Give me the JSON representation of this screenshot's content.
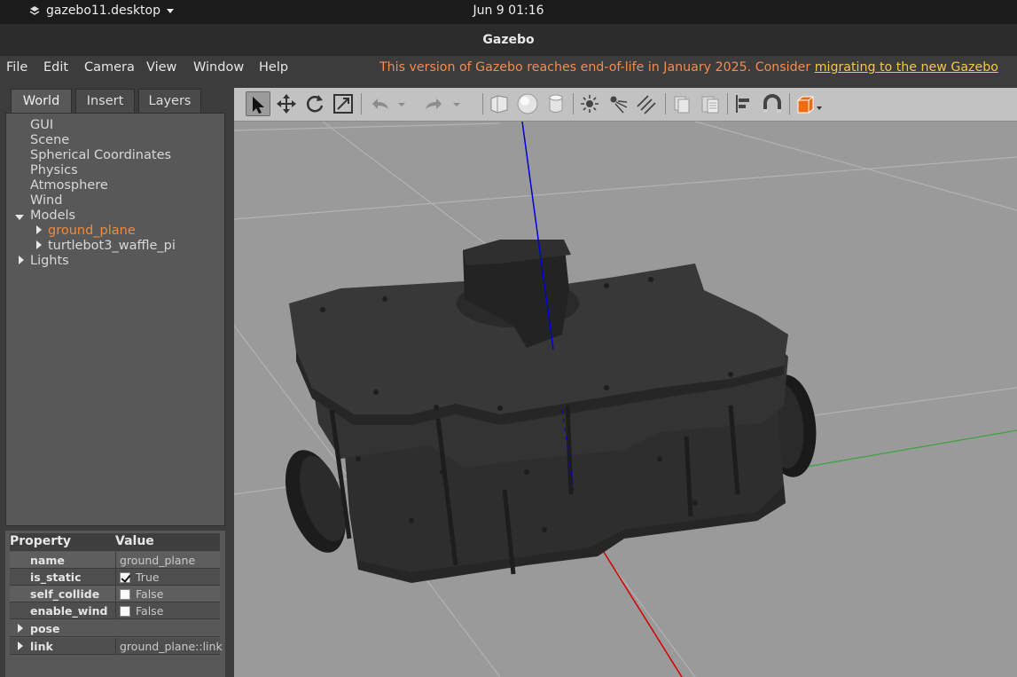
{
  "topbar": {
    "app_label": "gazebo11.desktop",
    "clock": "Jun 9  01:16"
  },
  "window": {
    "title": "Gazebo"
  },
  "menu": {
    "items": [
      "File",
      "Edit",
      "Camera",
      "View",
      "Window",
      "Help"
    ]
  },
  "notice": {
    "text": "This version of Gazebo reaches end-of-life in January 2025. Consider ",
    "link": "migrating to the new Gazebo"
  },
  "tabs": [
    "World",
    "Insert",
    "Layers"
  ],
  "tree": {
    "items": [
      "GUI",
      "Scene",
      "Spherical Coordinates",
      "Physics",
      "Atmosphere",
      "Wind"
    ],
    "models_label": "Models",
    "models": [
      "ground_plane",
      "turtlebot3_waffle_pi"
    ],
    "lights_label": "Lights",
    "selected": "ground_plane"
  },
  "properties": {
    "header_property": "Property",
    "header_value": "Value",
    "rows": [
      {
        "key": "name",
        "value": "ground_plane"
      },
      {
        "key": "is_static",
        "value": "True"
      },
      {
        "key": "self_collide",
        "value": "False"
      },
      {
        "key": "enable_wind",
        "value": "False"
      },
      {
        "key": "pose",
        "value": ""
      },
      {
        "key": "link",
        "value": "ground_plane::link"
      }
    ]
  },
  "toolbar": {
    "icons": [
      "select-mode-icon",
      "translate-mode-icon",
      "rotate-mode-icon",
      "scale-mode-icon",
      "undo-icon",
      "redo-icon",
      "box-shape-icon",
      "sphere-shape-icon",
      "cylinder-shape-icon",
      "point-light-icon",
      "spot-light-icon",
      "directional-light-icon",
      "copy-icon",
      "paste-icon",
      "align-icon",
      "snap-icon",
      "view-angle-icon"
    ]
  },
  "colors": {
    "selected": "#f28a3a",
    "notice": "#f58b4f",
    "link": "#f5c842",
    "viewport_bg": "#9a9a9a",
    "robot": "#333333"
  }
}
